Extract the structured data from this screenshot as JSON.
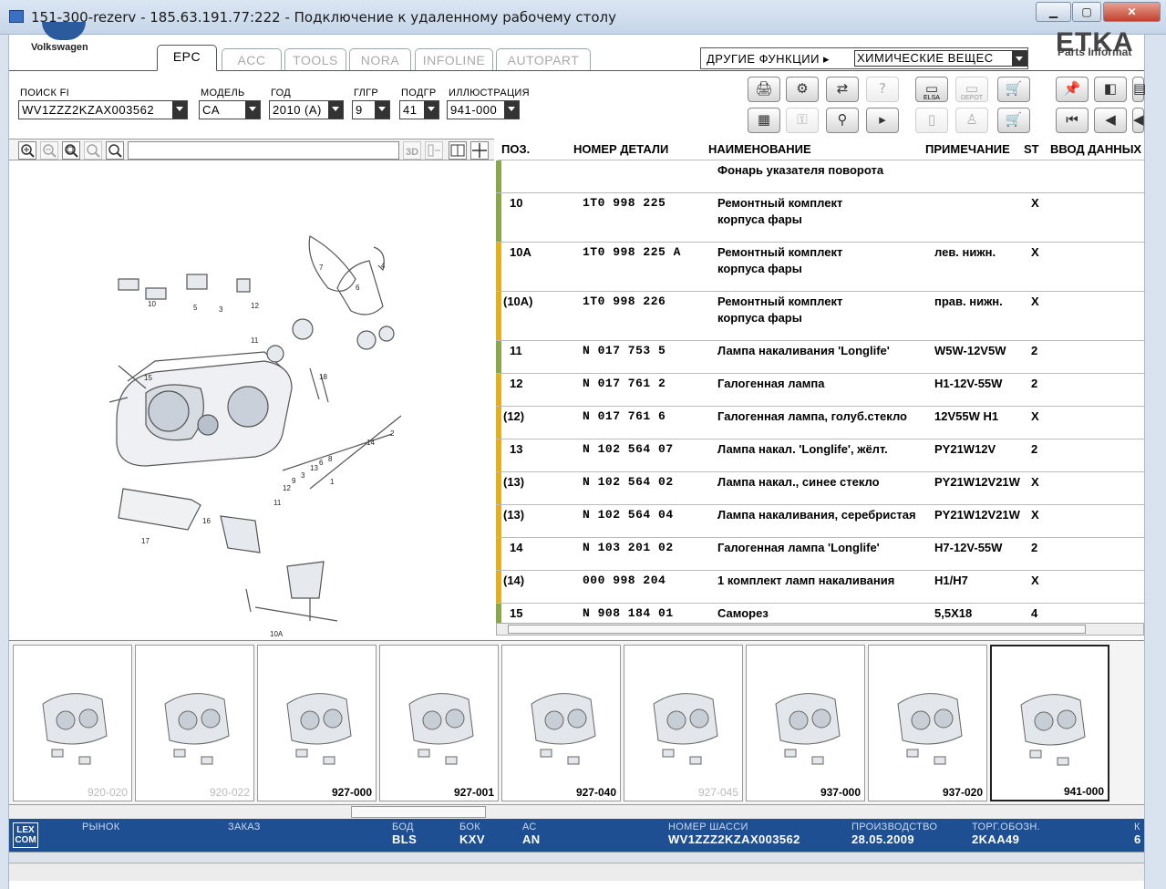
{
  "window": {
    "title": "151-300-rezerv - 185.63.191.77:222 - Подключение к удаленному рабочему столу"
  },
  "brand": {
    "name": "Volkswagen",
    "etka": "ETKA",
    "etka_sub": "Parts Informat"
  },
  "tabs": [
    {
      "label": "EPC",
      "active": true
    },
    {
      "label": "ACC"
    },
    {
      "label": "TOOLS"
    },
    {
      "label": "NORA"
    },
    {
      "label": "INFOLINE"
    },
    {
      "label": "AUTOPART"
    }
  ],
  "other_functions": {
    "label": "ДРУГИЕ ФУНКЦИИ ▸",
    "value": "ХИМИЧЕСКИЕ ВЕЩЕС"
  },
  "filters": {
    "search_fi": {
      "label": "ПОИСК FI",
      "value": "WV1ZZZ2KZAX003562"
    },
    "model": {
      "label": "МОДЕЛЬ",
      "value": "CA"
    },
    "year": {
      "label": "ГОД",
      "value": "2010 (A)"
    },
    "main_group": {
      "label": "ГЛГР",
      "value": "9"
    },
    "sub_group": {
      "label": "ПОДГР",
      "value": "41"
    },
    "illustration": {
      "label": "ИЛЛЮСТРАЦИЯ",
      "value": "941-000"
    }
  },
  "toolbar": {
    "icons": [
      "print-icon",
      "parts-icon",
      "exchange-icon",
      "question-icon",
      "elsa-icon",
      "depot-icon",
      "cart-icon",
      "pin-icon",
      "list-back-icon",
      "notes-icon",
      "table-icon",
      "key-icon",
      "vehicle-icon",
      "step-icon",
      "device-icon",
      "person-icon",
      "cart-add-icon",
      "first-page-icon",
      "prev-page-icon",
      "prev-icon"
    ],
    "elsa_label": "ELSA",
    "depot_label": "DEPOT"
  },
  "grid": {
    "headers": {
      "pos": "ПОЗ.",
      "part_no": "НОМЕР ДЕТАЛИ",
      "name": "НАИМЕНОВАНИЕ",
      "note": "ПРИМЕЧАНИЕ",
      "st": "ST",
      "data": "ВВОД ДАННЫХ"
    },
    "rows": [
      {
        "pos": "",
        "part_no": "",
        "name": "Фонарь указателя поворота",
        "name2": "",
        "note": "",
        "st": "",
        "bar": "#8aa84a"
      },
      {
        "pos": "10",
        "part_no": "1T0  998  225",
        "name": "Ремонтный комплект",
        "name2": "корпуса фары",
        "note": "",
        "st": "X",
        "bar": "#8aa84a"
      },
      {
        "pos": "10A",
        "part_no": "1T0  998  225  A",
        "name": "Ремонтный комплект",
        "name2": "корпуса фары",
        "note": "лев. нижн.",
        "st": "X",
        "bar": "#e0b020"
      },
      {
        "pos": "(10A)",
        "part_no": "1T0  998  226",
        "name": "Ремонтный комплект",
        "name2": "корпуса фары",
        "note": "прав. нижн.",
        "st": "X",
        "bar": "#e0b020"
      },
      {
        "pos": "11",
        "part_no": "N    017  753  5",
        "name": "Лампа накаливания 'Longlife'",
        "name2": "",
        "note": "W5W-12V5W",
        "st": "2",
        "bar": "#8aa84a"
      },
      {
        "pos": "12",
        "part_no": "N    017  761  2",
        "name": "Галогенная лампа",
        "name2": "",
        "note": "H1-12V-55W",
        "st": "2",
        "bar": "#e0b020"
      },
      {
        "pos": "(12)",
        "part_no": "N    017  761  6",
        "name": "Галогенная лампа, голуб.стекло",
        "name2": "",
        "note": "12V55W      H1",
        "st": "X",
        "bar": "#e0b020"
      },
      {
        "pos": "13",
        "part_no": "N    102  564  07",
        "name": "Лампа накал. 'Longlife', жёлт.",
        "name2": "",
        "note": "PY21W12V",
        "st": "2",
        "bar": "#e0b020"
      },
      {
        "pos": "(13)",
        "part_no": "N    102  564  02",
        "name": "Лампа накал., синее стекло",
        "name2": "",
        "note": "PY21W12V21W",
        "st": "X",
        "bar": "#e0b020"
      },
      {
        "pos": "(13)",
        "part_no": "N    102  564  04",
        "name": "Лампа накаливания, серебристая",
        "name2": "",
        "note": "PY21W12V21W",
        "st": "X",
        "bar": "#e0b020"
      },
      {
        "pos": "14",
        "part_no": "N    103  201  02",
        "name": "Галогенная лампа 'Longlife'",
        "name2": "",
        "note": "H7-12V-55W",
        "st": "2",
        "bar": "#e0b020"
      },
      {
        "pos": "(14)",
        "part_no": "000  998  204",
        "name": "1 комплект ламп накаливания",
        "name2": "",
        "note": "H1/H7",
        "st": "X",
        "bar": "#e0b020"
      },
      {
        "pos": "15",
        "part_no": "N    908  184  01",
        "name": "Саморез",
        "name2": "",
        "note": "5,5X18",
        "st": "4",
        "bar": "#8aa84a"
      }
    ]
  },
  "diagram": {
    "callouts": [
      "7",
      "4",
      "6",
      "10",
      "5",
      "3",
      "12",
      "11",
      "15",
      "18",
      "14",
      "2",
      "1",
      "11",
      "12",
      "9",
      "3",
      "13",
      "6",
      "8",
      "16",
      "17",
      "10A"
    ]
  },
  "thumbnails": [
    {
      "caption": "920-020",
      "highlight": false
    },
    {
      "caption": "920-022",
      "highlight": false
    },
    {
      "caption": "927-000",
      "highlight": true
    },
    {
      "caption": "927-001",
      "highlight": true
    },
    {
      "caption": "927-040",
      "highlight": true
    },
    {
      "caption": "927-045",
      "highlight": false
    },
    {
      "caption": "937-000",
      "highlight": true
    },
    {
      "caption": "937-020",
      "highlight": true
    },
    {
      "caption": "941-000",
      "highlight": true,
      "selected": true
    }
  ],
  "status": {
    "logo": "LEX COM",
    "market": {
      "label": "РЫНОК",
      "value": ""
    },
    "order": {
      "label": "ЗАКАЗ",
      "value": ""
    },
    "bod": {
      "label": "БОД",
      "value": "BLS"
    },
    "bok": {
      "label": "БОК",
      "value": "KXV"
    },
    "ac": {
      "label": "АС",
      "value": "AN"
    },
    "chassis": {
      "label": "НОМЕР ШАССИ",
      "value": "WV1ZZZ2KZAX003562"
    },
    "production": {
      "label": "ПРОИЗВОДСТВО",
      "value": "28.05.2009"
    },
    "trade": {
      "label": "ТОРГ.ОБОЗН.",
      "value": "2KAA49"
    },
    "k": {
      "label": "К",
      "value": "6"
    }
  }
}
